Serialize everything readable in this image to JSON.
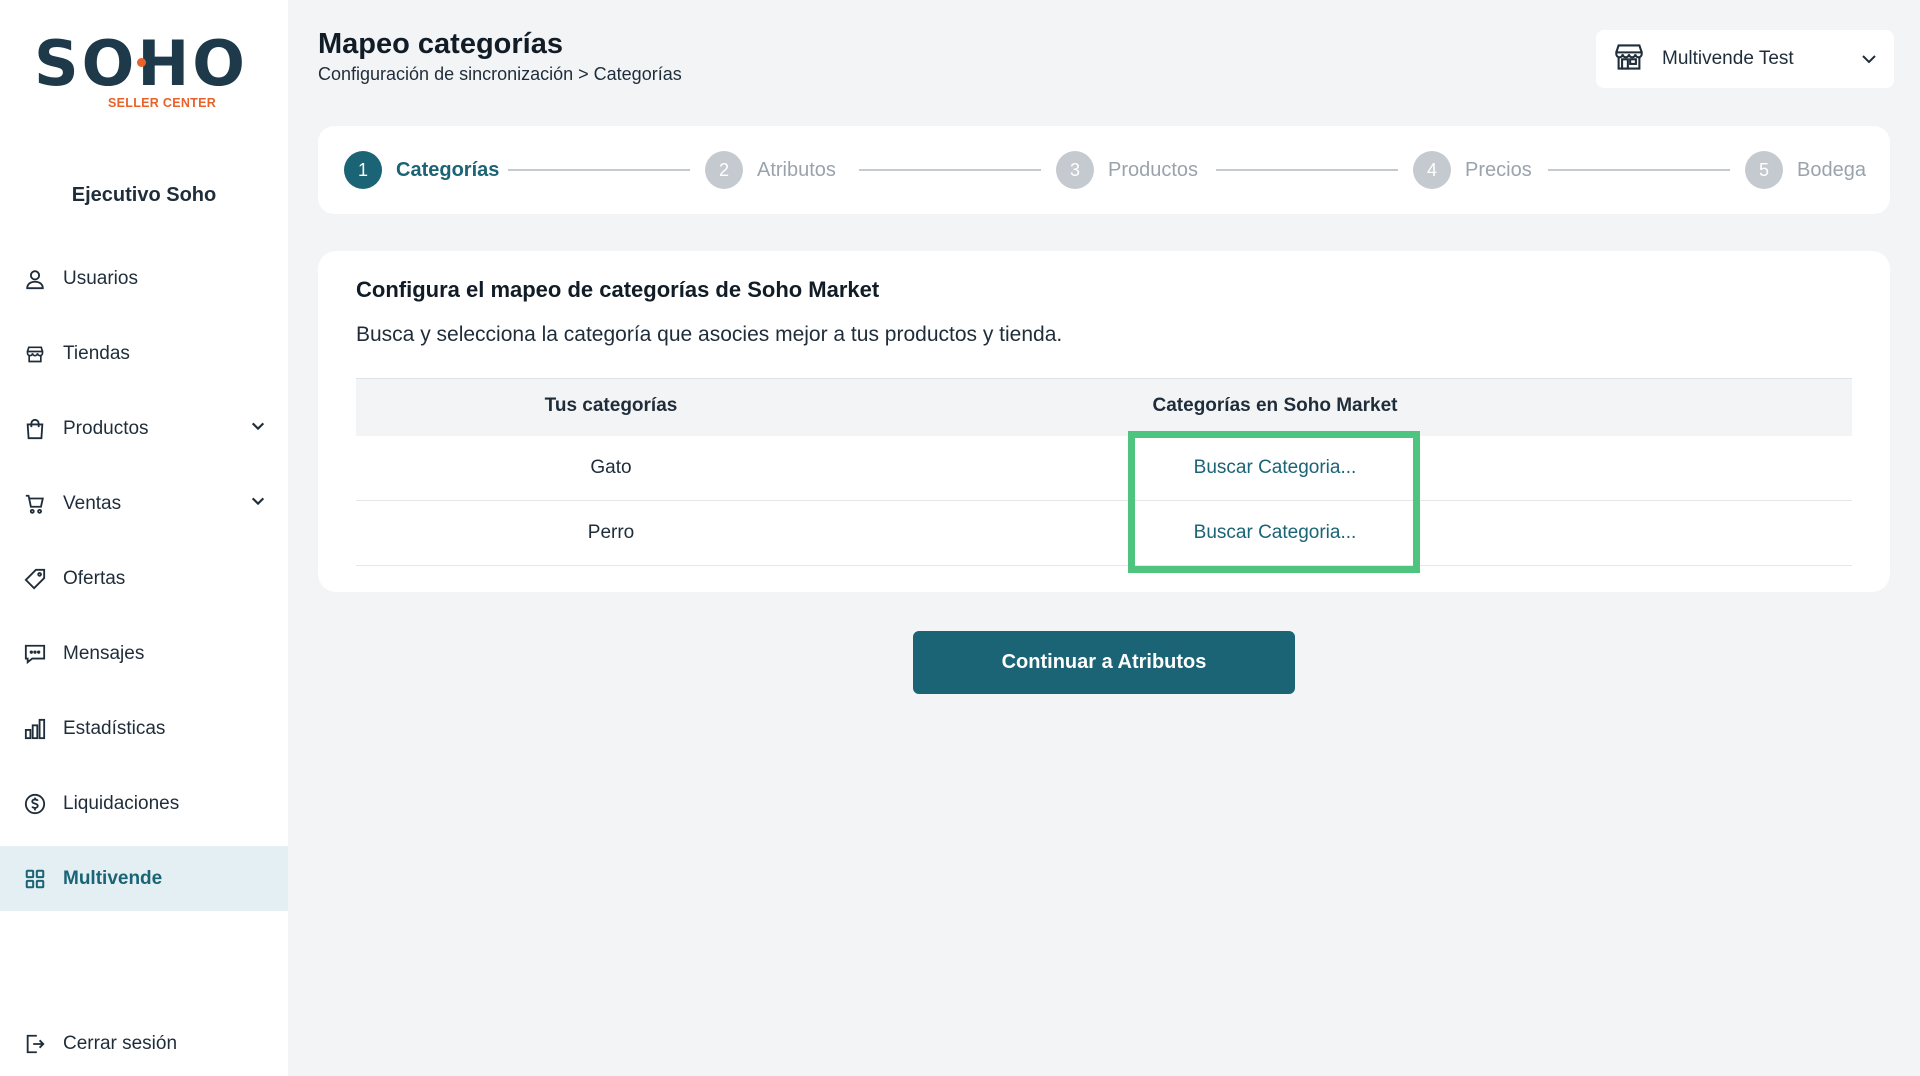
{
  "brand": {
    "logo_text": "SOHO",
    "logo_subtitle": "SELLER CENTER",
    "accent": "#e8622a",
    "primary": "#1a6475"
  },
  "sidebar": {
    "user_name": "Ejecutivo Soho",
    "items": [
      {
        "label": "Usuarios",
        "icon": "user-icon",
        "expandable": false
      },
      {
        "label": "Tiendas",
        "icon": "store-icon",
        "expandable": false
      },
      {
        "label": "Productos",
        "icon": "shopping-bag-icon",
        "expandable": true
      },
      {
        "label": "Ventas",
        "icon": "cart-icon",
        "expandable": true
      },
      {
        "label": "Ofertas",
        "icon": "tag-icon",
        "expandable": false
      },
      {
        "label": "Mensajes",
        "icon": "chat-icon",
        "expandable": false
      },
      {
        "label": "Estadísticas",
        "icon": "bar-chart-icon",
        "expandable": false
      },
      {
        "label": "Liquidaciones",
        "icon": "dollar-circle-icon",
        "expandable": false
      },
      {
        "label": "Multivende",
        "icon": "grid-icon",
        "expandable": false,
        "active": true
      }
    ],
    "logout_label": "Cerrar sesión"
  },
  "header": {
    "title": "Mapeo categorías",
    "breadcrumb": "Configuración de sincronización > Categorías",
    "store_selector": "Multivende Test"
  },
  "stepper": {
    "steps": [
      {
        "number": "1",
        "label": "Categorías",
        "active": true
      },
      {
        "number": "2",
        "label": "Atributos",
        "active": false
      },
      {
        "number": "3",
        "label": "Productos",
        "active": false
      },
      {
        "number": "4",
        "label": "Precios",
        "active": false
      },
      {
        "number": "5",
        "label": "Bodega",
        "active": false
      }
    ]
  },
  "card": {
    "title": "Configura el mapeo de categorías de Soho Market",
    "subtitle": "Busca y selecciona la categoría que asocies mejor a tus productos y tienda.",
    "columns": [
      "Tus categorías",
      "Categorías en Soho Market"
    ],
    "rows": [
      {
        "category": "Gato",
        "action": "Buscar Categoria..."
      },
      {
        "category": "Perro",
        "action": "Buscar Categoria..."
      }
    ]
  },
  "continue_button": "Continuar a Atributos"
}
